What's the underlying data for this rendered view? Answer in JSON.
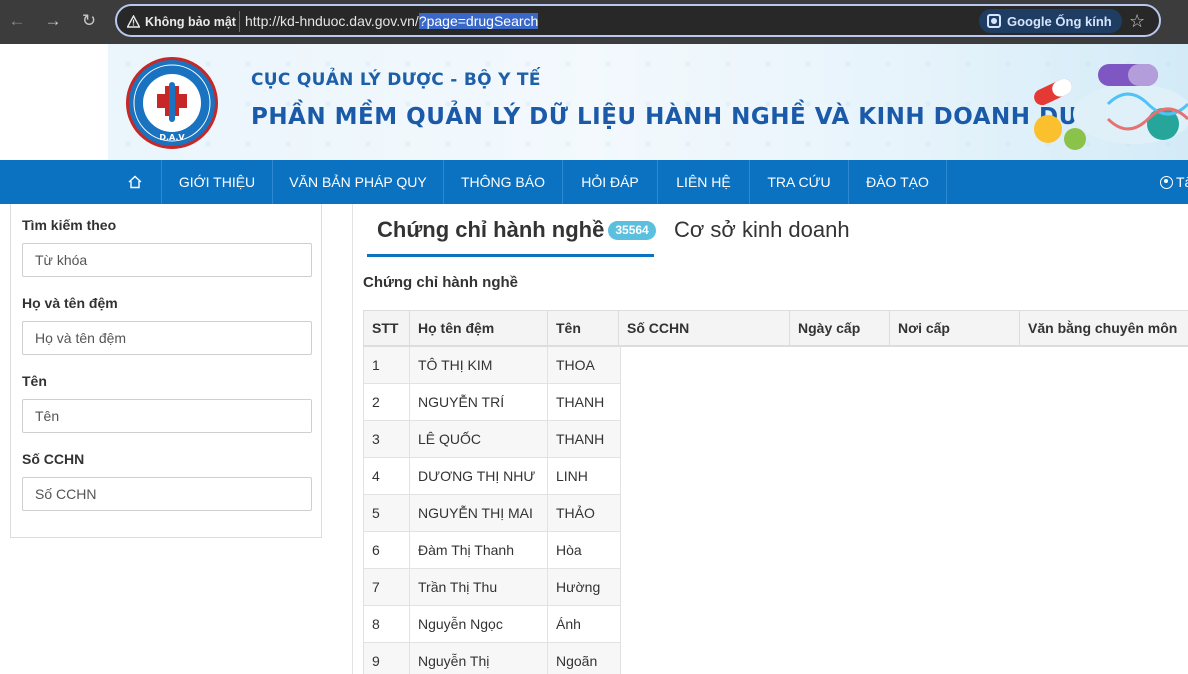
{
  "browser": {
    "security_label": "Không bảo mật",
    "url_base": "http://kd-hnduoc.dav.gov.vn/",
    "url_selected": "?page=drugSearch",
    "lens_label": "Google Ống kính",
    "star_icon": "star-icon"
  },
  "banner": {
    "line1": "CỤC QUẢN LÝ DƯỢC - BỘ Y TẾ",
    "line2": "PHẦN MỀM QUẢN LÝ DỮ LIỆU HÀNH NGHỀ VÀ KINH DOANH DƯỢC",
    "logo_text": "D.A.V",
    "brand_color": "#0b72c2",
    "title_color": "#1a5aa8"
  },
  "nav": {
    "items": [
      {
        "label": "GIỚI THIỆU"
      },
      {
        "label": "VĂN BẢN PHÁP QUY"
      },
      {
        "label": "THÔNG BÁO"
      },
      {
        "label": "HỎI ĐÁP"
      },
      {
        "label": "LIÊN HỆ"
      },
      {
        "label": "TRA CỨU"
      },
      {
        "label": "ĐÀO TẠO"
      }
    ],
    "user_label": "Tà"
  },
  "search": {
    "heading": "Tìm kiếm theo",
    "keyword_placeholder": "Từ khóa",
    "surname_label": "Họ và tên đệm",
    "surname_placeholder": "Họ và tên đệm",
    "name_label": "Tên",
    "name_placeholder": "Tên",
    "cert_label": "Số CCHN",
    "cert_placeholder": "Số CCHN"
  },
  "tabs": {
    "active_label": "Chứng chỉ hành nghề",
    "active_count": "35564",
    "second_label": "Cơ sở kinh doanh"
  },
  "section_title": "Chứng chỉ hành nghề",
  "table": {
    "headers": [
      "STT",
      "Họ tên đệm",
      "Tên",
      "Số CCHN",
      "Ngày cấp",
      "Nơi cấp",
      "Văn bằng chuyên môn"
    ],
    "rows": [
      {
        "stt": "1",
        "ho": "TÔ THỊ KIM",
        "ten": "THOA"
      },
      {
        "stt": "2",
        "ho": "NGUYỄN TRÍ",
        "ten": "THANH"
      },
      {
        "stt": "3",
        "ho": "LÊ QUỐC",
        "ten": "THANH"
      },
      {
        "stt": "4",
        "ho": "DƯƠNG THỊ NHƯ",
        "ten": "LINH"
      },
      {
        "stt": "5",
        "ho": "NGUYỄN THỊ MAI",
        "ten": "THẢO"
      },
      {
        "stt": "6",
        "ho": "Đàm Thị Thanh",
        "ten": "Hòa"
      },
      {
        "stt": "7",
        "ho": "Trần Thị Thu",
        "ten": "Hường"
      },
      {
        "stt": "8",
        "ho": "Nguyễn Ngọc",
        "ten": "Ánh"
      },
      {
        "stt": "9",
        "ho": "Nguyễn Thị",
        "ten": "Ngoãn"
      }
    ]
  }
}
